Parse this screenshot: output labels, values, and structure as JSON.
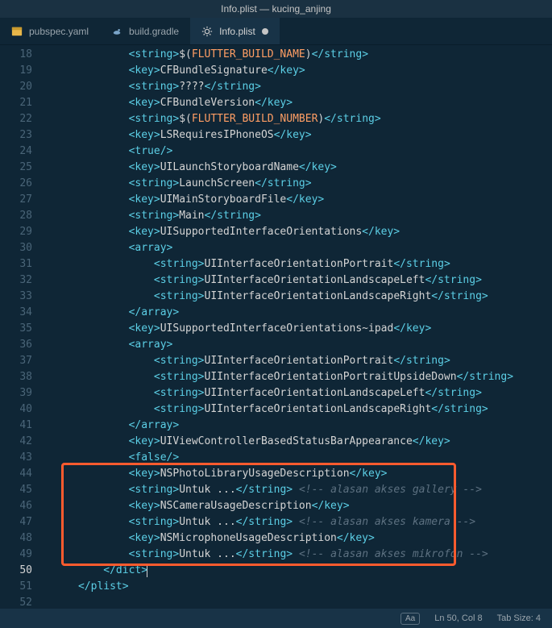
{
  "titlebar": "Info.plist — kucing_anjing",
  "tabs": [
    {
      "label": "pubspec.yaml",
      "icon": "yaml",
      "active": false,
      "dirty": false
    },
    {
      "label": "build.gradle",
      "icon": "gradle",
      "active": false,
      "dirty": false
    },
    {
      "label": "Info.plist",
      "icon": "gear",
      "active": true,
      "dirty": true
    }
  ],
  "lines": [
    {
      "n": 18,
      "indent": 2,
      "tokens": [
        [
          "tag",
          "<string>"
        ],
        [
          "plain",
          "$("
        ],
        [
          "var",
          "FLUTTER_BUILD_NAME"
        ],
        [
          "plain",
          ")"
        ],
        [
          "tag",
          "</string>"
        ]
      ]
    },
    {
      "n": 19,
      "indent": 2,
      "tokens": [
        [
          "tag",
          "<key>"
        ],
        [
          "plain",
          "CFBundleSignature"
        ],
        [
          "tag",
          "</key>"
        ]
      ]
    },
    {
      "n": 20,
      "indent": 2,
      "tokens": [
        [
          "tag",
          "<string>"
        ],
        [
          "plain",
          "????"
        ],
        [
          "tag",
          "</string>"
        ]
      ]
    },
    {
      "n": 21,
      "indent": 2,
      "tokens": [
        [
          "tag",
          "<key>"
        ],
        [
          "plain",
          "CFBundleVersion"
        ],
        [
          "tag",
          "</key>"
        ]
      ]
    },
    {
      "n": 22,
      "indent": 2,
      "tokens": [
        [
          "tag",
          "<string>"
        ],
        [
          "plain",
          "$("
        ],
        [
          "var",
          "FLUTTER_BUILD_NUMBER"
        ],
        [
          "plain",
          ")"
        ],
        [
          "tag",
          "</string>"
        ]
      ]
    },
    {
      "n": 23,
      "indent": 2,
      "tokens": [
        [
          "tag",
          "<key>"
        ],
        [
          "plain",
          "LSRequiresIPhoneOS"
        ],
        [
          "tag",
          "</key>"
        ]
      ]
    },
    {
      "n": 24,
      "indent": 2,
      "tokens": [
        [
          "tag",
          "<true/>"
        ]
      ]
    },
    {
      "n": 25,
      "indent": 2,
      "tokens": [
        [
          "tag",
          "<key>"
        ],
        [
          "plain",
          "UILaunchStoryboardName"
        ],
        [
          "tag",
          "</key>"
        ]
      ]
    },
    {
      "n": 26,
      "indent": 2,
      "tokens": [
        [
          "tag",
          "<string>"
        ],
        [
          "plain",
          "LaunchScreen"
        ],
        [
          "tag",
          "</string>"
        ]
      ]
    },
    {
      "n": 27,
      "indent": 2,
      "tokens": [
        [
          "tag",
          "<key>"
        ],
        [
          "plain",
          "UIMainStoryboardFile"
        ],
        [
          "tag",
          "</key>"
        ]
      ]
    },
    {
      "n": 28,
      "indent": 2,
      "tokens": [
        [
          "tag",
          "<string>"
        ],
        [
          "plain",
          "Main"
        ],
        [
          "tag",
          "</string>"
        ]
      ]
    },
    {
      "n": 29,
      "indent": 2,
      "tokens": [
        [
          "tag",
          "<key>"
        ],
        [
          "plain",
          "UISupportedInterfaceOrientations"
        ],
        [
          "tag",
          "</key>"
        ]
      ]
    },
    {
      "n": 30,
      "indent": 2,
      "tokens": [
        [
          "tag",
          "<array>"
        ]
      ]
    },
    {
      "n": 31,
      "indent": 3,
      "tokens": [
        [
          "tag",
          "<string>"
        ],
        [
          "plain",
          "UIInterfaceOrientationPortrait"
        ],
        [
          "tag",
          "</string>"
        ]
      ]
    },
    {
      "n": 32,
      "indent": 3,
      "tokens": [
        [
          "tag",
          "<string>"
        ],
        [
          "plain",
          "UIInterfaceOrientationLandscapeLeft"
        ],
        [
          "tag",
          "</string>"
        ]
      ]
    },
    {
      "n": 33,
      "indent": 3,
      "tokens": [
        [
          "tag",
          "<string>"
        ],
        [
          "plain",
          "UIInterfaceOrientationLandscapeRight"
        ],
        [
          "tag",
          "</string>"
        ]
      ]
    },
    {
      "n": 34,
      "indent": 2,
      "tokens": [
        [
          "tag",
          "</array>"
        ]
      ]
    },
    {
      "n": 35,
      "indent": 2,
      "tokens": [
        [
          "tag",
          "<key>"
        ],
        [
          "plain",
          "UISupportedInterfaceOrientations~ipad"
        ],
        [
          "tag",
          "</key>"
        ]
      ]
    },
    {
      "n": 36,
      "indent": 2,
      "tokens": [
        [
          "tag",
          "<array>"
        ]
      ]
    },
    {
      "n": 37,
      "indent": 3,
      "tokens": [
        [
          "tag",
          "<string>"
        ],
        [
          "plain",
          "UIInterfaceOrientationPortrait"
        ],
        [
          "tag",
          "</string>"
        ]
      ]
    },
    {
      "n": 38,
      "indent": 3,
      "tokens": [
        [
          "tag",
          "<string>"
        ],
        [
          "plain",
          "UIInterfaceOrientationPortraitUpsideDown"
        ],
        [
          "tag",
          "</string>"
        ]
      ]
    },
    {
      "n": 39,
      "indent": 3,
      "tokens": [
        [
          "tag",
          "<string>"
        ],
        [
          "plain",
          "UIInterfaceOrientationLandscapeLeft"
        ],
        [
          "tag",
          "</string>"
        ]
      ]
    },
    {
      "n": 40,
      "indent": 3,
      "tokens": [
        [
          "tag",
          "<string>"
        ],
        [
          "plain",
          "UIInterfaceOrientationLandscapeRight"
        ],
        [
          "tag",
          "</string>"
        ]
      ]
    },
    {
      "n": 41,
      "indent": 2,
      "tokens": [
        [
          "tag",
          "</array>"
        ]
      ]
    },
    {
      "n": 42,
      "indent": 2,
      "tokens": [
        [
          "tag",
          "<key>"
        ],
        [
          "plain",
          "UIViewControllerBasedStatusBarAppearance"
        ],
        [
          "tag",
          "</key>"
        ]
      ]
    },
    {
      "n": 43,
      "indent": 2,
      "tokens": [
        [
          "tag",
          "<false/>"
        ]
      ]
    },
    {
      "n": 44,
      "indent": 2,
      "tokens": [
        [
          "tag",
          "<key>"
        ],
        [
          "plain",
          "NSPhotoLibraryUsageDescription"
        ],
        [
          "tag",
          "</key>"
        ]
      ]
    },
    {
      "n": 45,
      "indent": 2,
      "tokens": [
        [
          "tag",
          "<string>"
        ],
        [
          "plain",
          "Untuk ..."
        ],
        [
          "tag",
          "</string>"
        ],
        [
          "plain",
          " "
        ],
        [
          "comment",
          "<!-- alasan akses gallery -->"
        ]
      ]
    },
    {
      "n": 46,
      "indent": 2,
      "tokens": [
        [
          "tag",
          "<key>"
        ],
        [
          "plain",
          "NSCameraUsageDescription"
        ],
        [
          "tag",
          "</key>"
        ]
      ]
    },
    {
      "n": 47,
      "indent": 2,
      "tokens": [
        [
          "tag",
          "<string>"
        ],
        [
          "plain",
          "Untuk ..."
        ],
        [
          "tag",
          "</string>"
        ],
        [
          "plain",
          " "
        ],
        [
          "comment",
          "<!-- alasan akses kamera -->"
        ]
      ]
    },
    {
      "n": 48,
      "indent": 2,
      "tokens": [
        [
          "tag",
          "<key>"
        ],
        [
          "plain",
          "NSMicrophoneUsageDescription"
        ],
        [
          "tag",
          "</key>"
        ]
      ]
    },
    {
      "n": 49,
      "indent": 2,
      "tokens": [
        [
          "tag",
          "<string>"
        ],
        [
          "plain",
          "Untuk ..."
        ],
        [
          "tag",
          "</string>"
        ],
        [
          "plain",
          " "
        ],
        [
          "comment",
          "<!-- alasan akses mikrofon -->"
        ]
      ]
    },
    {
      "n": 50,
      "indent": 1,
      "current": true,
      "tokens": [
        [
          "tag",
          "</dict>"
        ],
        [
          "cursor",
          ""
        ]
      ]
    },
    {
      "n": 51,
      "indent": 0,
      "tokens": [
        [
          "tag",
          "</plist>"
        ]
      ]
    },
    {
      "n": 52,
      "indent": 0,
      "tokens": []
    }
  ],
  "highlight": {
    "startLine": 44,
    "endLine": 49
  },
  "status": {
    "case": "Aa",
    "position": "Ln 50, Col 8",
    "tab": "Tab Size: 4"
  },
  "indentWidth": 4,
  "baseIndentCols": 6
}
